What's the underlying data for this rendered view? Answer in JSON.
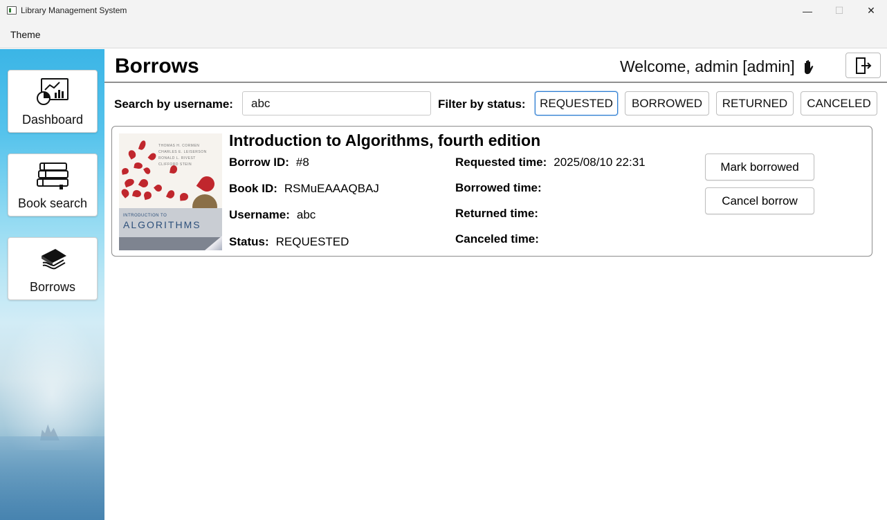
{
  "window": {
    "title": "Library Management System",
    "minimize_glyph": "—",
    "maximize_glyph": "☐",
    "close_glyph": "✕"
  },
  "menu": {
    "items": [
      "Theme"
    ]
  },
  "sidebar": {
    "items": [
      {
        "label": "Dashboard",
        "icon": "dashboard-chart-icon"
      },
      {
        "label": "Book search",
        "icon": "books-stack-icon"
      },
      {
        "label": "Borrows",
        "icon": "hand-book-icon"
      }
    ]
  },
  "header": {
    "title": "Borrows",
    "welcome": "Welcome, admin [admin]",
    "wave_icon": "waving-hand-icon",
    "logout_icon": "logout-door-icon"
  },
  "filters": {
    "search_label": "Search by username:",
    "search_value": "abc",
    "status_label": "Filter by status:",
    "statuses": [
      "REQUESTED",
      "BORROWED",
      "RETURNED",
      "CANCELED"
    ],
    "selected_status": "REQUESTED"
  },
  "borrows": [
    {
      "book_title": "Introduction to Algorithms, fourth edition",
      "borrow_id_label": "Borrow ID:",
      "borrow_id": "#8",
      "book_id_label": "Book ID:",
      "book_id": "RSMuEAAAQBAJ",
      "username_label": "Username:",
      "username": "abc",
      "status_label": "Status:",
      "status": "REQUESTED",
      "requested_label": "Requested time:",
      "requested_time": "2025/08/10 22:31",
      "borrowed_label": "Borrowed time:",
      "borrowed_time": "",
      "returned_label": "Returned time:",
      "returned_time": "",
      "canceled_label": "Canceled time:",
      "canceled_time": "",
      "actions": [
        "Mark borrowed",
        "Cancel borrow"
      ],
      "cover": {
        "series": "INTRODUCTION TO",
        "word": "ALGORITHMS",
        "authors": [
          "THOMAS H. CORMEN",
          "CHARLES E. LEISERSON",
          "RONALD L. RIVEST",
          "CLIFFORD STEIN"
        ]
      }
    }
  ],
  "colors": {
    "accent": "#2d7dd2",
    "card_border": "#8c8c8c",
    "cover_red": "#c0272d"
  }
}
